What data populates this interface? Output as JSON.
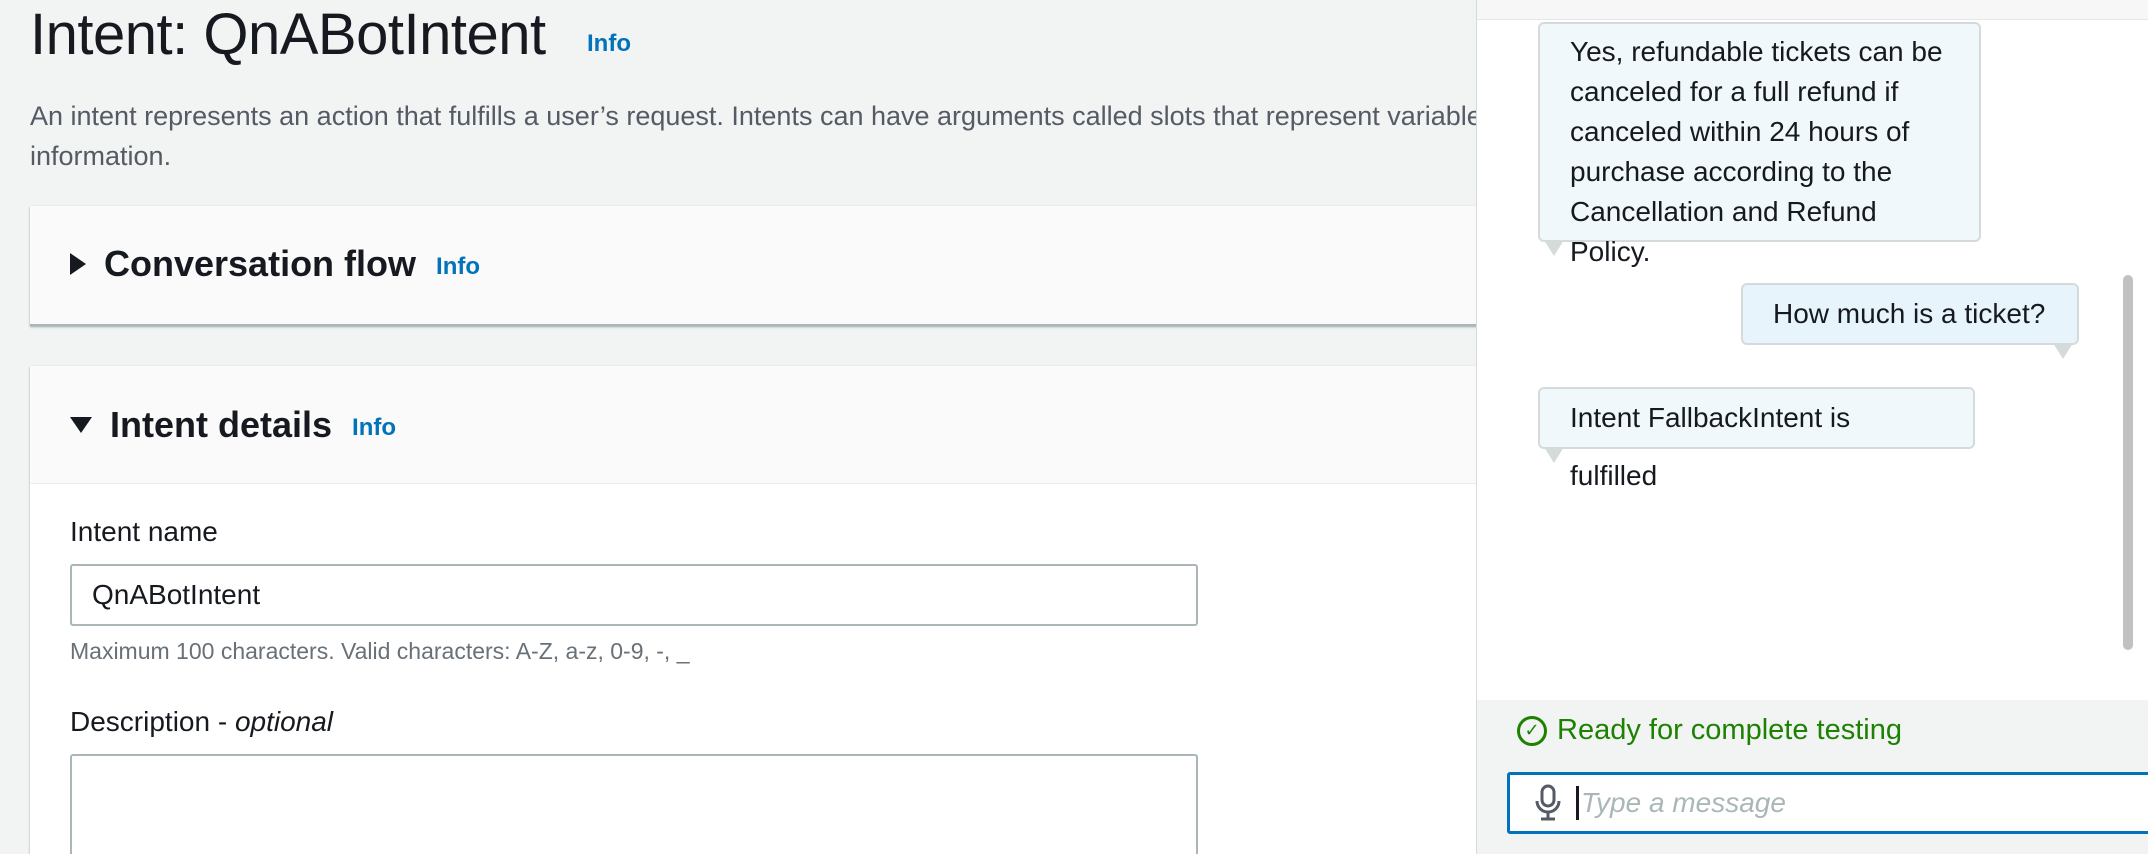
{
  "page": {
    "title": "Intent: QnABotIntent",
    "title_info": "Info",
    "description": "An intent represents an action that fulfills a user’s request. Intents can have arguments called slots that represent variable information."
  },
  "conversation_flow": {
    "title": "Conversation flow",
    "info": "Info"
  },
  "intent_details": {
    "title": "Intent details",
    "info": "Info",
    "name_label": "Intent name",
    "name_value": "QnABotIntent",
    "name_hint": "Maximum 100 characters. Valid characters: A-Z, a-z, 0-9, -, _",
    "description_label": "Description - ",
    "description_optional": "optional",
    "description_value": ""
  },
  "chat": {
    "messages": [
      {
        "sender": "bot",
        "text": "Yes, refundable tickets can be canceled for a full refund if canceled within 24 hours of purchase according to the Cancellation and Refund Policy."
      },
      {
        "sender": "user",
        "text": "How much is a ticket?"
      },
      {
        "sender": "bot",
        "text": "Intent FallbackIntent is fulfilled"
      }
    ],
    "status": "Ready for complete testing",
    "input_placeholder": "Type a message"
  },
  "colors": {
    "link": "#0073bb",
    "success": "#1d8102",
    "focus": "#0073bb"
  },
  "icons": [
    "caret-right-icon",
    "caret-down-icon",
    "check-circle-icon",
    "microphone-icon"
  ]
}
